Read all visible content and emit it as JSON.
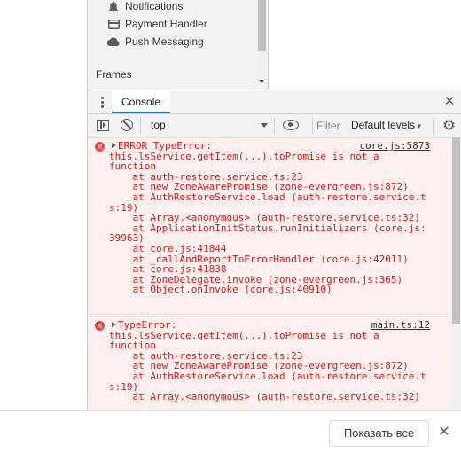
{
  "app_nav": {
    "items": [
      {
        "label": "Notifications",
        "icon": "bell-icon"
      },
      {
        "label": "Payment Handler",
        "icon": "card-icon"
      },
      {
        "label": "Push Messaging",
        "icon": "cloud-icon"
      }
    ],
    "frames_label": "Frames"
  },
  "drawer": {
    "tab_label": "Console"
  },
  "toolbar": {
    "context": "top",
    "filter_placeholder": "Filter",
    "levels": "Default levels"
  },
  "messages": [
    {
      "source": "core.js:5873",
      "lines": [
        "ERROR TypeError:",
        "this.lsService.getItem(...).toPromise is not a",
        "function",
        "    at auth-restore.service.ts:23",
        "    at new ZoneAwarePromise (zone-evergreen.js:872)",
        "    at AuthRestoreService.load (auth-restore.service.t",
        "s:19)",
        "    at Array.<anonymous> (auth-restore.service.ts:32)",
        "    at ApplicationInitStatus.runInitializers (core.js:",
        "39963)",
        "    at core.js:41844",
        "    at _callAndReportToErrorHandler (core.js:42011)",
        "    at core.js:41838",
        "    at ZoneDelegate.invoke (zone-evergreen.js:365)",
        "    at Object.onInvoke (core.js:40910)"
      ]
    },
    {
      "source": "main.ts:12",
      "lines": [
        "TypeError:",
        "this.lsService.getItem(...).toPromise is not a",
        "function",
        "    at auth-restore.service.ts:23",
        "    at new ZoneAwarePromise (zone-evergreen.js:872)",
        "    at AuthRestoreService.load (auth-restore.service.t",
        "s:19)",
        "    at Array.<anonymous> (auth-restore.service.ts:32)"
      ]
    }
  ],
  "bottom_bar": {
    "show_all_label": "Показать все"
  },
  "colors": {
    "error_text": "#d01b13",
    "error_bg": "#fff0f0",
    "accent": "#1a73e8"
  }
}
